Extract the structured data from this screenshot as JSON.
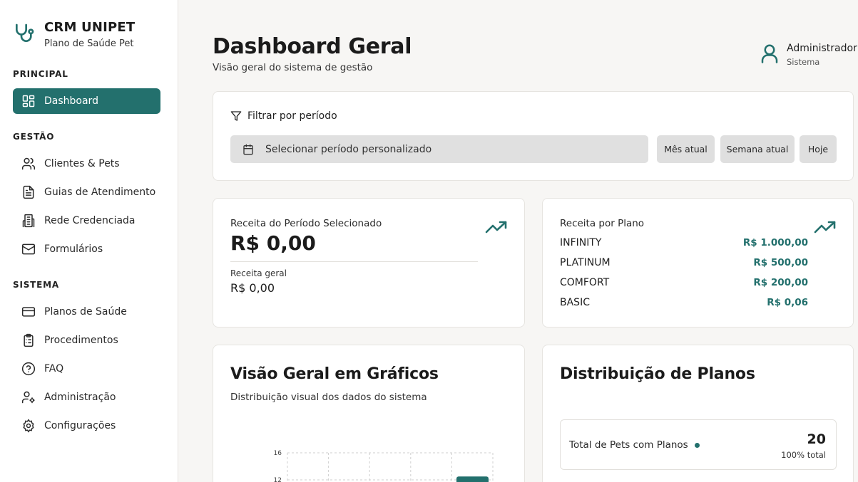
{
  "brand": {
    "title": "CRM UNIPET",
    "subtitle": "Plano de Saúde Pet",
    "icon": "stethoscope-icon"
  },
  "sidebar": {
    "sections": [
      {
        "label": "PRINCIPAL"
      },
      {
        "label": "GESTÃO"
      },
      {
        "label": "SISTEMA"
      }
    ],
    "items": [
      {
        "label": "Dashboard",
        "icon": "dashboard-grid-icon",
        "active": true
      },
      {
        "label": "Clientes & Pets",
        "icon": "users-icon"
      },
      {
        "label": "Guias de Atendimento",
        "icon": "file-text-icon"
      },
      {
        "label": "Rede Credenciada",
        "icon": "building-icon"
      },
      {
        "label": "Formulários",
        "icon": "mail-icon"
      },
      {
        "label": "Planos de Saúde",
        "icon": "credit-card-icon"
      },
      {
        "label": "Procedimentos",
        "icon": "clipboard-list-icon"
      },
      {
        "label": "FAQ",
        "icon": "help-circle-icon"
      },
      {
        "label": "Administração",
        "icon": "user-cog-icon"
      },
      {
        "label": "Configurações",
        "icon": "settings-icon"
      }
    ]
  },
  "header": {
    "title": "Dashboard Geral",
    "subtitle": "Visão geral do sistema de gestão",
    "user": {
      "name": "Administrador",
      "role": "Sistema"
    }
  },
  "filter": {
    "title": "Filtrar por período",
    "period_placeholder": "Selecionar período personalizado",
    "quick": [
      "Mês atual",
      "Semana atual",
      "Hoje"
    ]
  },
  "revenue": {
    "label": "Receita do Período Selecionado",
    "value": "R$ 0,00",
    "general_label": "Receita geral",
    "general_value": "R$ 0,00"
  },
  "plan_revenue": {
    "label": "Receita por Plano",
    "plans": [
      {
        "name": "INFINITY",
        "value": "R$ 1.000,00"
      },
      {
        "name": "PLATINUM",
        "value": "R$ 500,00"
      },
      {
        "name": "COMFORT",
        "value": "R$ 200,00"
      },
      {
        "name": "BASIC",
        "value": "R$ 0,06"
      }
    ]
  },
  "charts_section": {
    "title": "Visão Geral em Gráficos",
    "subtitle": "Distribuição visual dos dados do sistema"
  },
  "distribution": {
    "title": "Distribuição de Planos",
    "total_label": "Total de Pets com Planos",
    "total_value": "20",
    "total_pct": "100% total"
  },
  "colors": {
    "accent": "#23706d",
    "sidebar_bg": "#ffffff",
    "page_bg": "#f7f6f4"
  },
  "chart_data": {
    "type": "bar",
    "y_ticks": [
      "16",
      "12"
    ],
    "ylim": [
      0,
      16
    ],
    "visible_bar_value_min": 12
  }
}
